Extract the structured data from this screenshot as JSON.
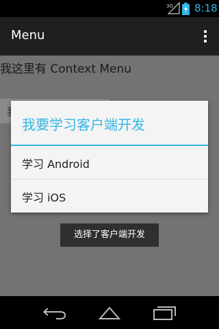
{
  "status_bar": {
    "network_label": "3G",
    "time": "8:18",
    "accent_color": "#33b5e5"
  },
  "action_bar": {
    "title": "Menu",
    "overflow_icon": "overflow-menu-icon"
  },
  "content": {
    "text": "我这里有 Context Menu",
    "hidden_button_text": "我"
  },
  "context_menu": {
    "title": "我要学习客户端开发",
    "items": [
      {
        "label": "学习 Android"
      },
      {
        "label": "学习 iOS"
      }
    ]
  },
  "toast": {
    "text": "选择了客户端开发"
  },
  "nav_bar": {
    "back_icon": "back-icon",
    "home_icon": "home-icon",
    "recent_icon": "recent-apps-icon"
  }
}
